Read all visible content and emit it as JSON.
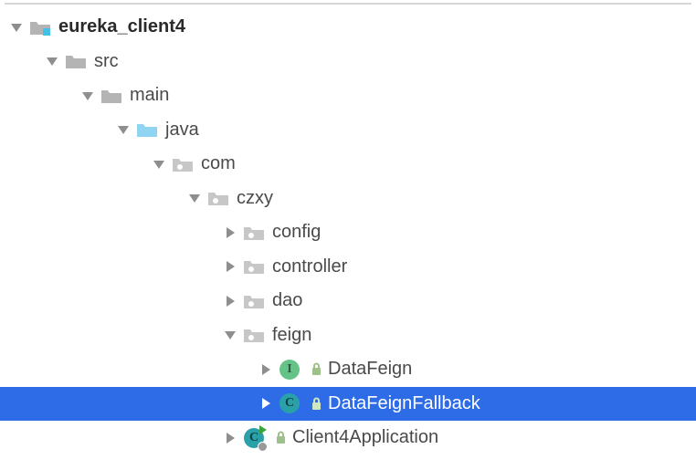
{
  "colors": {
    "selection": "#2e6be6",
    "arrow": "#8e8e8e",
    "arrow_selected": "#ffffff",
    "folder_gray": "#b4b4b4",
    "folder_blue": "#8fd4f0",
    "package_gray": "#c7c7c7",
    "interface_bg": "#66c388",
    "class_bg": "#2aa1a8",
    "lock": "#9fc08a",
    "lock_selected": "#cfe6c2"
  },
  "tree": {
    "root": {
      "label": "eureka_client4",
      "icon": "module-folder",
      "expanded": true,
      "children": [
        {
          "label": "src",
          "icon": "folder-gray",
          "expanded": true,
          "children": [
            {
              "label": "main",
              "icon": "folder-gray",
              "expanded": true,
              "children": [
                {
                  "label": "java",
                  "icon": "folder-blue",
                  "expanded": true,
                  "children": [
                    {
                      "label": "com",
                      "icon": "package",
                      "expanded": true,
                      "children": [
                        {
                          "label": "czxy",
                          "icon": "package",
                          "expanded": true,
                          "children": [
                            {
                              "label": "config",
                              "icon": "package",
                              "expanded": false
                            },
                            {
                              "label": "controller",
                              "icon": "package",
                              "expanded": false
                            },
                            {
                              "label": "dao",
                              "icon": "package",
                              "expanded": false
                            },
                            {
                              "label": "feign",
                              "icon": "package",
                              "expanded": true,
                              "children": [
                                {
                                  "label": "DataFeign",
                                  "icon": "interface",
                                  "letter": "I",
                                  "lock": true,
                                  "expanded": false
                                },
                                {
                                  "label": "DataFeignFallback",
                                  "icon": "class",
                                  "letter": "C",
                                  "lock": true,
                                  "expanded": false,
                                  "selected": true
                                }
                              ]
                            },
                            {
                              "label": "Client4Application",
                              "icon": "application",
                              "letter": "C",
                              "lock": true,
                              "expanded": false
                            }
                          ]
                        }
                      ]
                    }
                  ]
                }
              ]
            }
          ]
        }
      ]
    }
  }
}
